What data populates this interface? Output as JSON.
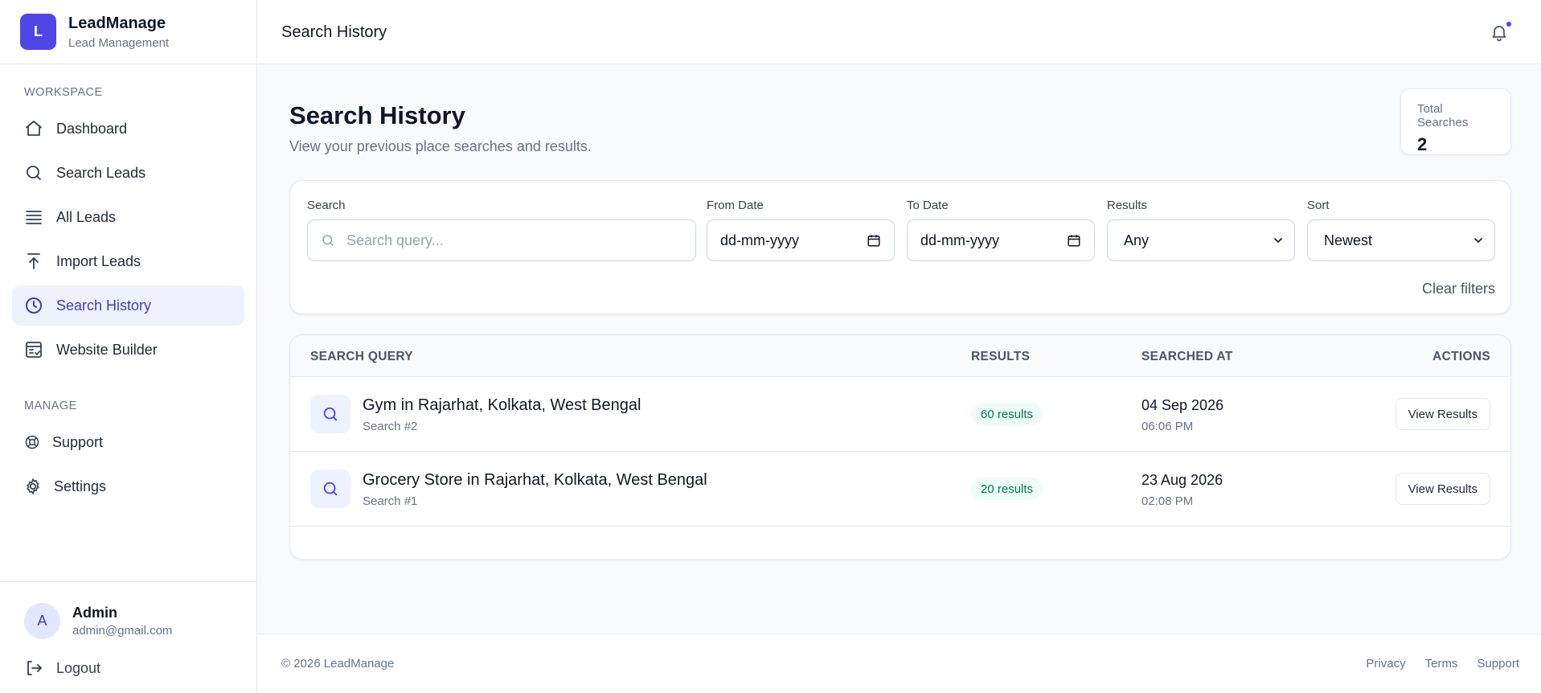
{
  "brand": {
    "logo_letter": "L",
    "name": "LeadManage",
    "subtitle": "Lead Management"
  },
  "sidebar": {
    "workspace_label": "WORKSPACE",
    "items": [
      {
        "label": "Dashboard",
        "icon": "home-icon"
      },
      {
        "label": "Search Leads",
        "icon": "search-icon"
      },
      {
        "label": "All Leads",
        "icon": "list-icon"
      },
      {
        "label": "Import Leads",
        "icon": "upload-icon"
      },
      {
        "label": "Search History",
        "icon": "clock-icon",
        "active": true
      },
      {
        "label": "Website Builder",
        "icon": "website-icon"
      }
    ],
    "manage_label": "MANAGE",
    "manage_items": [
      {
        "label": "Support",
        "icon": "lifebuoy-icon"
      },
      {
        "label": "Settings",
        "icon": "gear-icon"
      }
    ],
    "user": {
      "initial": "A",
      "name": "Admin",
      "email": "admin@gmail.com"
    },
    "logout_label": "Logout"
  },
  "header": {
    "title": "Search History"
  },
  "page": {
    "title": "Search History",
    "subtitle": "View your previous place searches and results.",
    "total_label": "Total Searches",
    "total_value": "2"
  },
  "filters": {
    "search_label": "Search",
    "search_placeholder": "Search query...",
    "from_label": "From Date",
    "from_value": "dd-mm-yyyy",
    "to_label": "To Date",
    "to_value": "dd-mm-yyyy",
    "results_label": "Results",
    "results_value": "Any",
    "sort_label": "Sort",
    "sort_value": "Newest",
    "clear_label": "Clear filters"
  },
  "table": {
    "headers": {
      "query": "SEARCH QUERY",
      "results": "RESULTS",
      "searched_at": "SEARCHED AT",
      "actions": "ACTIONS"
    },
    "rows": [
      {
        "query": "Gym in Rajarhat, Kolkata, West Bengal",
        "sub": "Search #2",
        "results": "60 results",
        "date": "04 Sep 2026",
        "time": "06:06 PM",
        "action": "View Results"
      },
      {
        "query": "Grocery Store in Rajarhat, Kolkata, West Bengal",
        "sub": "Search #1",
        "results": "20 results",
        "date": "23 Aug 2026",
        "time": "02:08 PM",
        "action": "View Results"
      }
    ]
  },
  "footer": {
    "copyright": "© 2026 LeadManage",
    "links": [
      "Privacy",
      "Terms",
      "Support"
    ]
  },
  "colors": {
    "accent": "#4f46e5",
    "badge_bg": "#ecfdf5",
    "badge_text": "#047857"
  }
}
